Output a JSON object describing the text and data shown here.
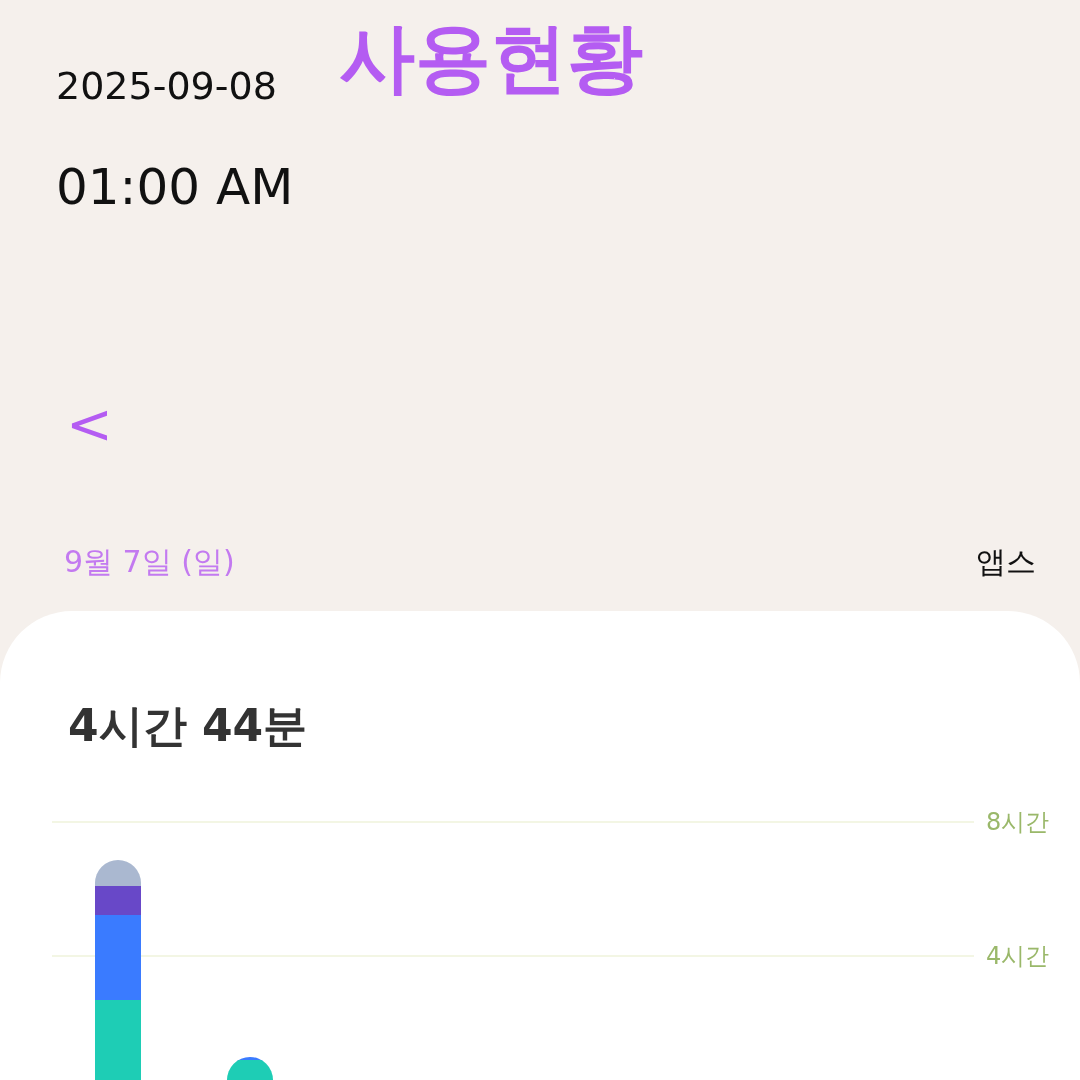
{
  "header": {
    "date": "2025-09-08",
    "title": "사용현황",
    "time": "01:00 AM"
  },
  "nav": {
    "back": "<"
  },
  "day_bar": {
    "day": "9월 7일 (일)",
    "view": "앱스"
  },
  "card": {
    "total": "4시간 44분",
    "gridlines": [
      {
        "label": "8시간"
      },
      {
        "label": "4시간"
      }
    ]
  }
}
